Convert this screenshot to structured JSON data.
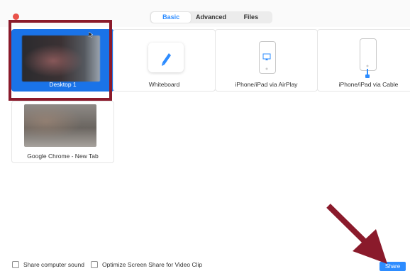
{
  "tabs": [
    {
      "label": "Basic",
      "active": true
    },
    {
      "label": "Advanced",
      "active": false
    },
    {
      "label": "Files",
      "active": false
    }
  ],
  "cards": [
    {
      "label": "Desktop 1",
      "selected": true
    },
    {
      "label": "Whiteboard",
      "selected": false
    },
    {
      "label": "iPhone/iPad via AirPlay",
      "selected": false
    },
    {
      "label": "iPhone/iPad via Cable",
      "selected": false
    },
    {
      "label": "Google Chrome - New Tab",
      "selected": false
    }
  ],
  "footer": {
    "share_sound": "Share computer sound",
    "optimize_video": "Optimize Screen Share for Video Clip",
    "share_button": "Share"
  },
  "colors": {
    "accent": "#2d8cff",
    "selected": "#1a73e8",
    "highlight": "#8a1a2b"
  }
}
